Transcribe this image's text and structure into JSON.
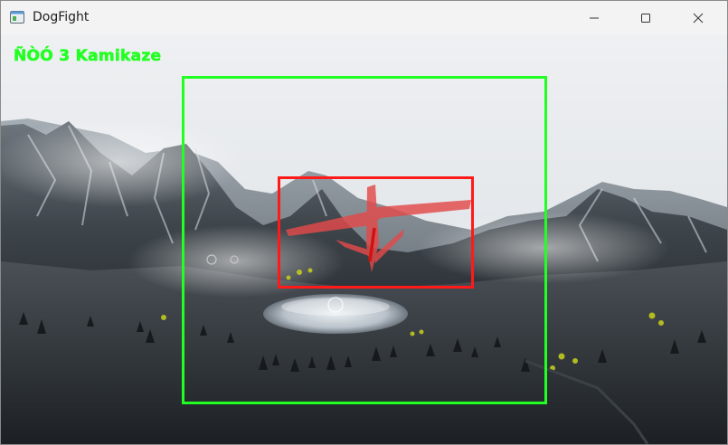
{
  "window": {
    "title": "DogFight",
    "app_icon": "window-app-icon",
    "controls": {
      "minimize_icon": "minimize-icon",
      "maximize_icon": "maximize-icon",
      "close_icon": "close-icon"
    }
  },
  "hud": {
    "target_label": "ÑÒÓ 3 Kamikaze",
    "label_color": "#22ff22",
    "search_box_color": "#22ff22",
    "lock_box_color": "#ff1a1a"
  },
  "scene": {
    "description_icons": [
      "mountains",
      "lake",
      "forest",
      "drone-aircraft"
    ]
  }
}
